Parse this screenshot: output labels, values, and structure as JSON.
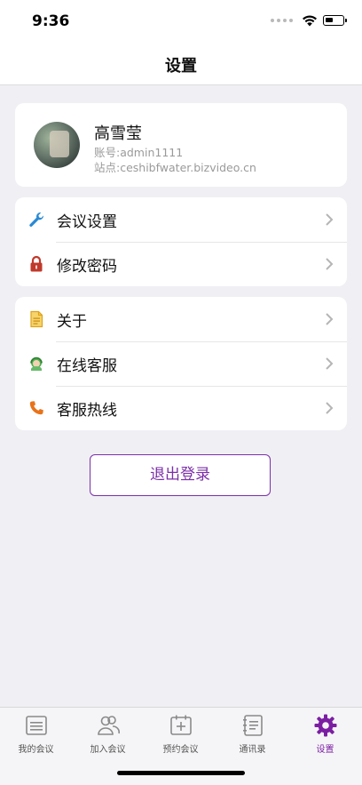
{
  "status": {
    "time": "9:36"
  },
  "nav": {
    "title": "设置"
  },
  "profile": {
    "name": "高雪莹",
    "account_line": "账号:admin1111",
    "site_line": "站点:ceshibfwater.bizvideo.cn"
  },
  "menu_group_1": [
    {
      "label": "会议设置",
      "icon": "wrench-icon",
      "color": "#2a8ad4"
    },
    {
      "label": "修改密码",
      "icon": "lock-icon",
      "color": "#c0392b"
    }
  ],
  "menu_group_2": [
    {
      "label": "关于",
      "icon": "document-icon",
      "color": "#e0a21b"
    },
    {
      "label": "在线客服",
      "icon": "support-agent-icon",
      "color": "#4caf50"
    },
    {
      "label": "客服热线",
      "icon": "phone-icon",
      "color": "#e8731a"
    }
  ],
  "logout_label": "退出登录",
  "tabbar": {
    "items": [
      {
        "label": "我的会议",
        "icon": "meeting-list-icon"
      },
      {
        "label": "加入会议",
        "icon": "people-icon"
      },
      {
        "label": "预约会议",
        "icon": "calendar-plus-icon"
      },
      {
        "label": "通讯录",
        "icon": "contacts-book-icon"
      },
      {
        "label": "设置",
        "icon": "gear-icon",
        "active": true
      }
    ]
  },
  "colors": {
    "accent": "#7b1fa2",
    "background": "#f0eff4"
  }
}
